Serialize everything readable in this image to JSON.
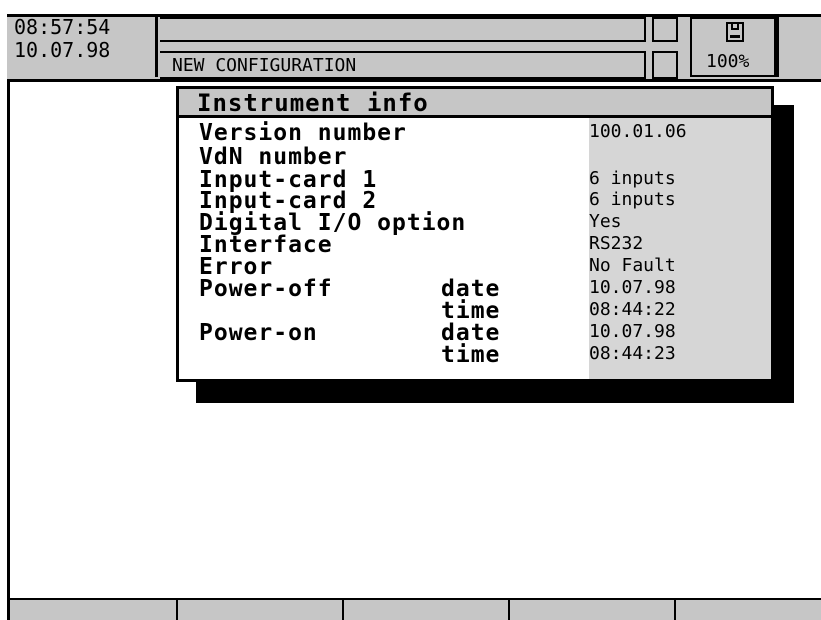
{
  "status": {
    "time": "08:57:54",
    "date": "10.07.98",
    "title": "NEW CONFIGURATION",
    "disk_icon": "floppy-disk-icon",
    "memory_level": "100%"
  },
  "dialog": {
    "title": "Instrument info",
    "rows": [
      {
        "label": "Version number",
        "sub": "",
        "value": "100.01.06"
      },
      {
        "label": "VdN number",
        "sub": "",
        "value": ""
      },
      {
        "label": "Input-card 1",
        "sub": "",
        "value": "6 inputs"
      },
      {
        "label": "Input-card 2",
        "sub": "",
        "value": "6 inputs"
      },
      {
        "label": "Digital I/O option",
        "sub": "",
        "value": "Yes"
      },
      {
        "label": "Interface",
        "sub": "",
        "value": "RS232"
      },
      {
        "label": "Error",
        "sub": "",
        "value": "No Fault"
      },
      {
        "label": "Power-off",
        "sub": "date",
        "value": "10.07.98"
      },
      {
        "label": "",
        "sub": "time",
        "value": "08:44:22"
      },
      {
        "label": "Power-on",
        "sub": "date",
        "value": "10.07.98"
      },
      {
        "label": "",
        "sub": "time",
        "value": "08:44:23"
      }
    ]
  },
  "softkeys": [
    "",
    "",
    "",
    "",
    ""
  ],
  "colors": {
    "panel": "#c6c6c6",
    "value_column": "#d6d6d6",
    "background": "#ffffff",
    "foreground": "#000000"
  }
}
